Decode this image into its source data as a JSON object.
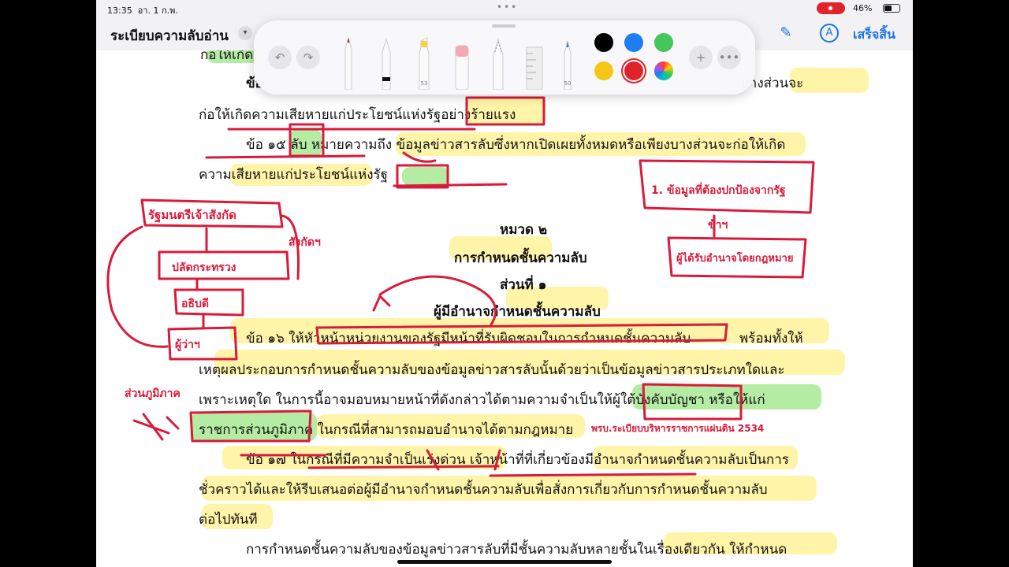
{
  "status_bar": {
    "time": "13:35",
    "date": "อา. 1 ก.พ.",
    "battery": "46%"
  },
  "nav": {
    "title": "ระเบียบความลับอ่าน",
    "done": "เสร็จสิ้น"
  },
  "doc": {
    "l1": "ก่อให้เกิด",
    "l2a": "ข้อ",
    "l2b": "บางส่วนจะ",
    "l3": "ก่อให้เกิดความเสียหายแก่ประโยชน์แห่งรัฐอย่างร้ายแรง",
    "l4": "ข้อ ๑๕ ลับ หมายความถึง ข้อมูลข่าวสารลับซึ่งหากเปิดเผยทั้งหมดหรือเพียงบางส่วนจะก่อให้เกิด",
    "l5": "ความเสียหายแก่ประโยชน์แห่งรัฐ",
    "h1": "หมวด ๒",
    "h2": "การกำหนดชั้นความลับ",
    "h3": "ส่วนที่ ๑",
    "h4": "ผู้มีอำนาจกำหนดชั้นความลับ",
    "p1a": "ข้อ ๑๖ ให้หัวหน้าหน่วยงานของรัฐมีหน้าที่รับผิดชอบในการกำหนดชั้นความลับ",
    "p1b": "พร้อมทั้งให้",
    "p2": "เหตุผลประกอบการกำหนดชั้นความลับของข้อมูลข่าวสารลับนั้นด้วยว่าเป็นข้อมูลข่าวสารประเภทใดและ",
    "p3": "เพราะเหตุใด ในการนี้อาจมอบหมายหน้าที่ดังกล่าวได้ตามความจำเป็นให้ผู้ใต้บังคับบัญชา หรือให้แก่",
    "p4": "ราชการส่วนภูมิภาค ในกรณีที่สามารถมอบอำนาจได้ตามกฎหมาย",
    "q1": "ข้อ ๑๗ ในกรณีที่มีความจำเป็นเร่งด่วน เจ้าหน้าที่ที่เกี่ยวข้องมีอำนาจกำหนดชั้นความลับเป็นการ",
    "q2": "ชั่วคราวได้และให้รีบเสนอต่อผู้มีอำนาจกำหนดชั้นความลับเพื่อสั่งการเกี่ยวกับการกำหนดชั้นความลับ",
    "q3": "ต่อไปทันที",
    "r1": "การกำหนดชั้นความลับของข้อมูลข่าวสารลับที่มีชั้นความลับหลายชั้นในเรื่องเดียวกัน ให้กำหนด"
  },
  "annotations": {
    "box1": "รัฐมนตรีเจ้าสังกัด",
    "box2": "ปลัดกระทรวง",
    "box3": "อธิบดี",
    "box4": "ผู้ว่าฯ",
    "side1": "สังกัดฯ",
    "side2": "ส่วนภูมิภาค",
    "right1": "1. ข้อมูลที่ต้องปกป้องจากรัฐ",
    "right2": "ข้าฯ",
    "right3": "ผู้ได้รับอำนาจโดยกฎหมาย",
    "law": "พรบ.ระเบียบบริหารราชการแผ่นดิน 2534"
  },
  "toolbar": {
    "undo": "undo-icon",
    "redo": "redo-icon",
    "add": "plus-icon",
    "more": "more-icon",
    "marker_label": "53",
    "ruler_label": "50",
    "colors": [
      "#000000",
      "#1e7df0",
      "#43c75b",
      "#f5c518",
      "#e0222b"
    ],
    "selected_color": "#e0222b"
  },
  "colors": {
    "ink": "#d81b3a",
    "accent": "#1a73e8"
  }
}
